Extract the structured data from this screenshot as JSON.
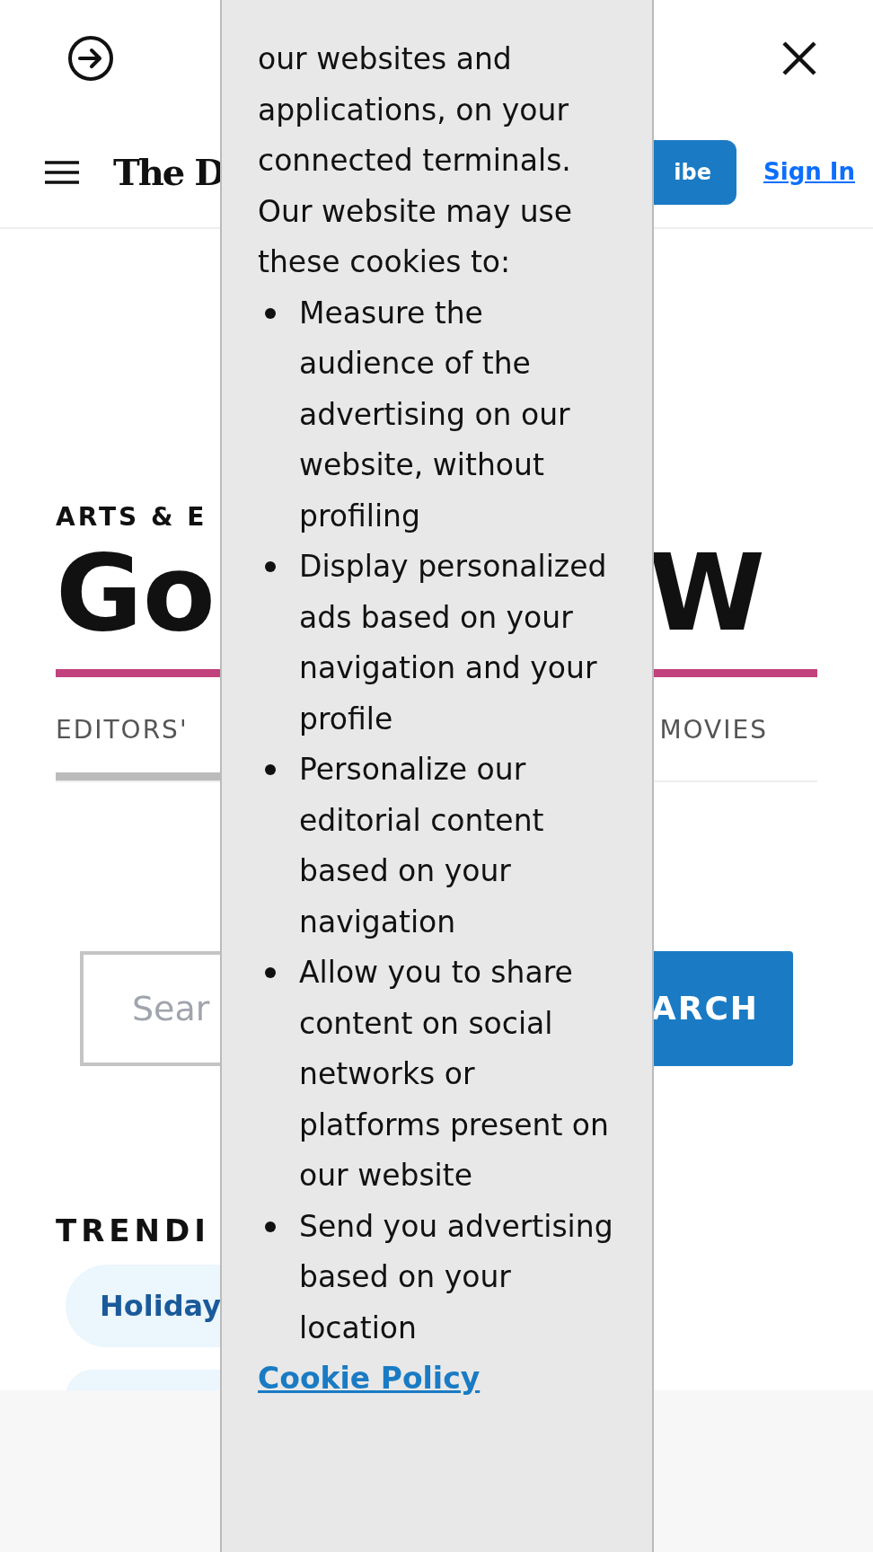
{
  "header": {
    "logo": "The D",
    "subscribe_button": "ibe",
    "sign_in": "Sign In"
  },
  "section": {
    "kicker": "ARTS & E",
    "title_left": "Go",
    "title_right": "W"
  },
  "tabs": [
    {
      "label": "EDITORS'",
      "selected": true
    },
    {
      "label": "MOVIES",
      "selected": false
    }
  ],
  "search": {
    "placeholder": "Sear",
    "button": "ARCH"
  },
  "trending": {
    "heading": "TRENDI",
    "tags": [
      "Holiday"
    ]
  },
  "cookie_panel": {
    "paragraphs": [
      "our websites and applications, on your connected terminals.",
      "Our website may use these cookies to:"
    ],
    "purposes": [
      "Measure the audience of the advertising on our website, without profiling",
      "Display personalized ads based on your navigation and your profile",
      "Personalize our editorial content based on your navigation",
      "Allow you to share content on social networks or platforms present on our website",
      "Send you advertising based on your location"
    ],
    "link": "Cookie Policy"
  }
}
